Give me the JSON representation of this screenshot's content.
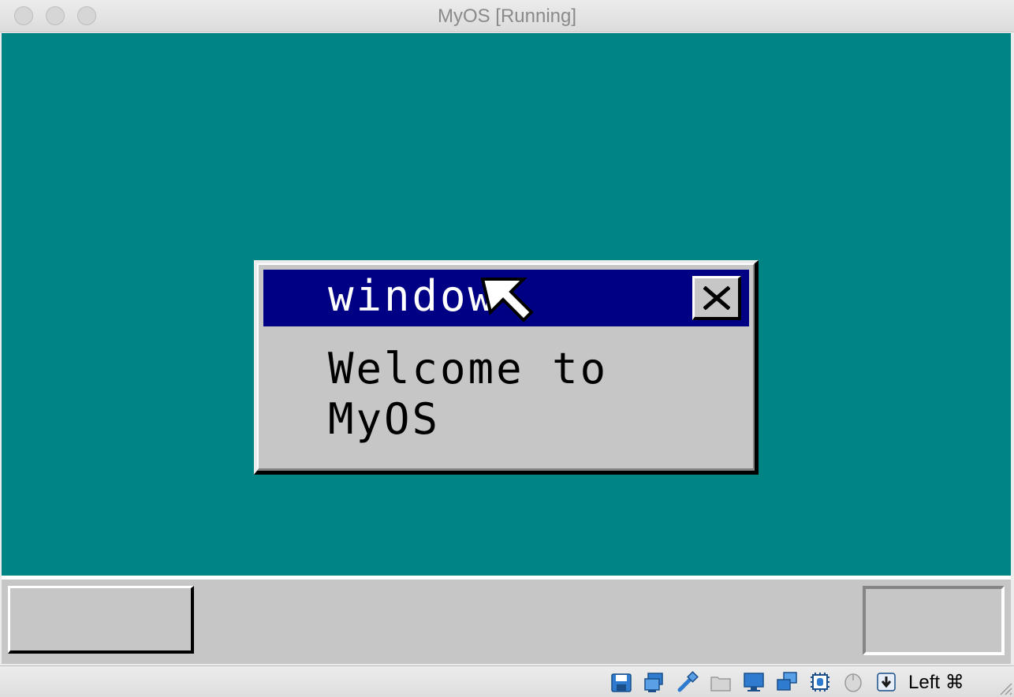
{
  "host_window": {
    "title": "MyOS [Running]"
  },
  "guest_window": {
    "title": "window",
    "message_line1": "Welcome to",
    "message_line2": "MyOS"
  },
  "colors": {
    "desktop": "#008484",
    "titlebar_active": "#000084",
    "window_face": "#c6c6c6"
  },
  "statusbar": {
    "icons": [
      "hard-disk-icon",
      "optical-drive-icon",
      "usb-icon",
      "shared-folder-icon",
      "display-icon",
      "network-icon",
      "cpu-icon",
      "mouse-integration-icon",
      "keyboard-capture-icon"
    ],
    "host_key_label": "Left ⌘"
  }
}
